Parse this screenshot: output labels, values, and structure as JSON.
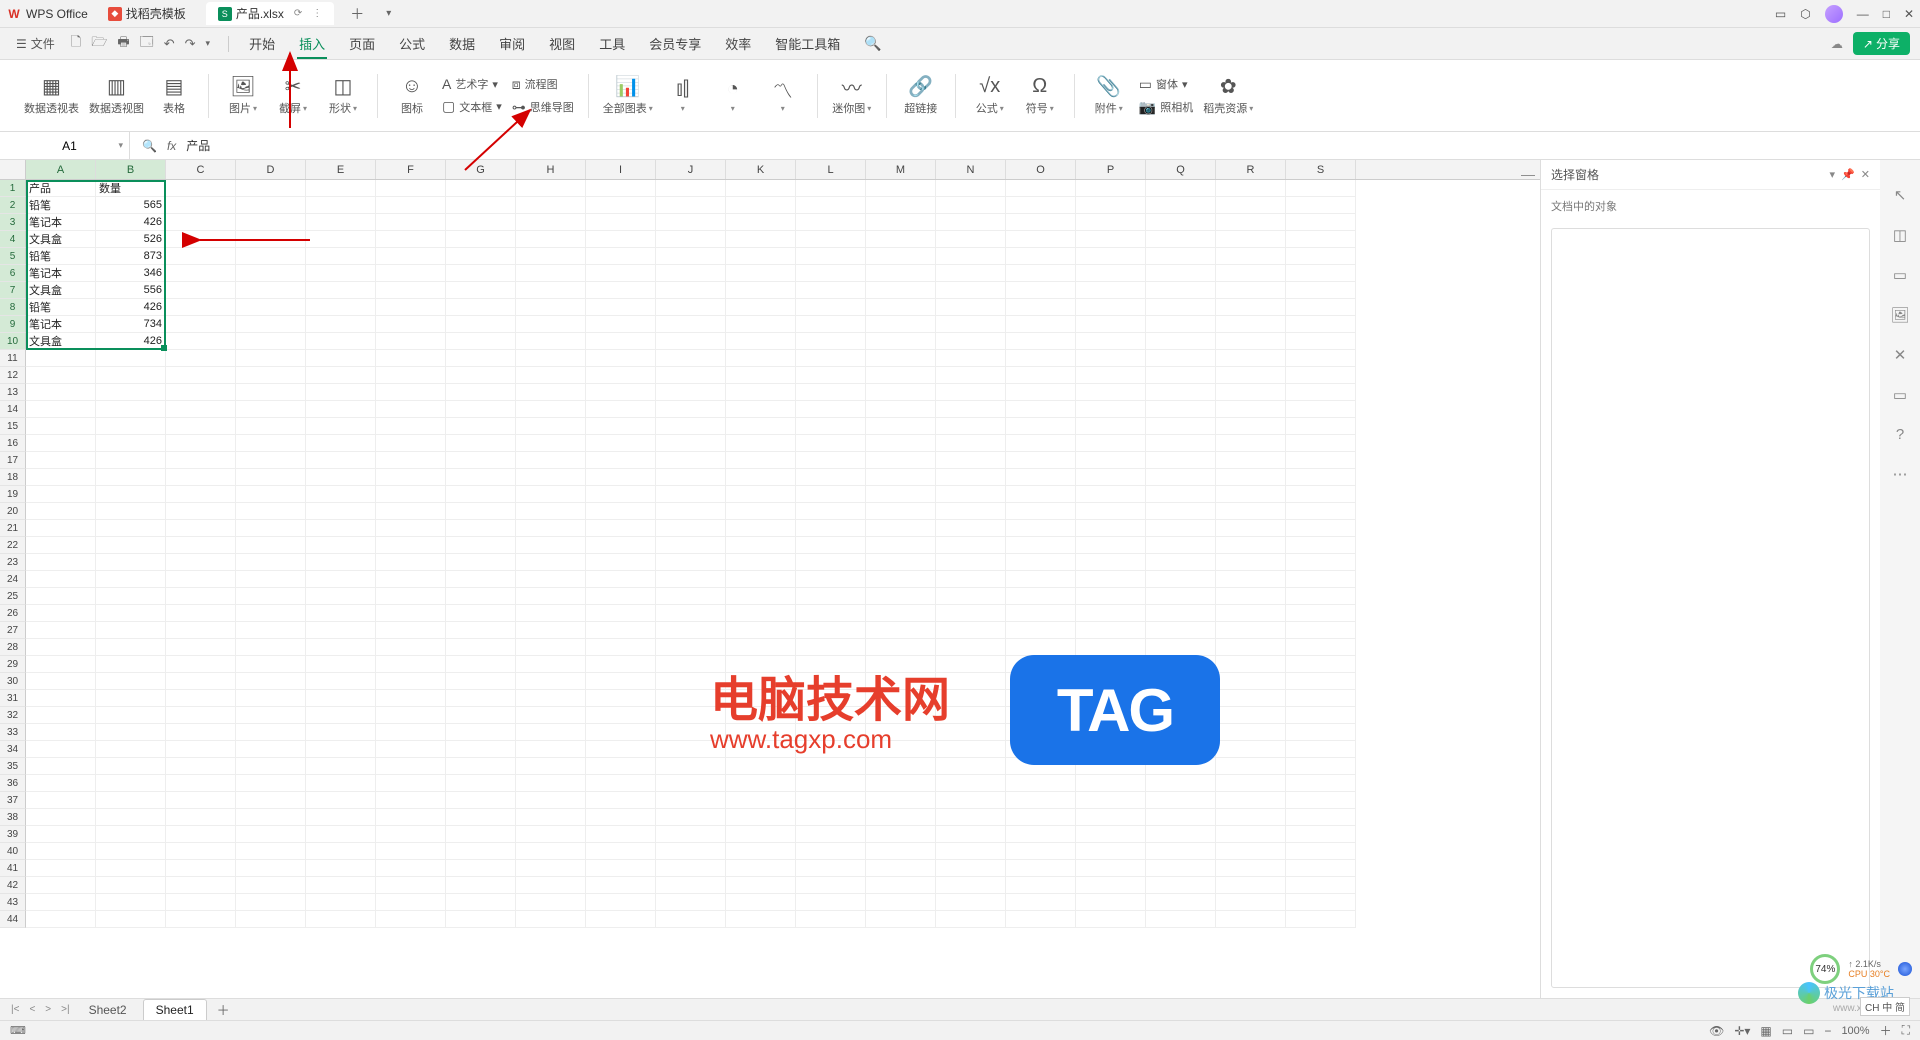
{
  "app": {
    "name": "WPS Office"
  },
  "tabs": {
    "inactive_label": "找稻壳模板",
    "active_label": "产品.xlsx"
  },
  "win": {
    "minimize": "—",
    "maximize": "□",
    "close": "✕"
  },
  "menu": {
    "file": "文件",
    "tabs": [
      "开始",
      "插入",
      "页面",
      "公式",
      "数据",
      "审阅",
      "视图",
      "工具",
      "会员专享",
      "效率",
      "智能工具箱"
    ],
    "active_index": 1,
    "share": "分享"
  },
  "ribbon": {
    "g1": {
      "pivot_table": "数据透视表",
      "pivot_chart": "数据透视图",
      "table": "表格"
    },
    "g2": {
      "picture": "图片",
      "screenshot": "截屏",
      "shape": "形状"
    },
    "g3": {
      "icons": "图标",
      "wordart": "艺术字",
      "textbox": "文本框",
      "flowchart": "流程图",
      "mindmap": "思维导图"
    },
    "g4": {
      "all_charts": "全部图表"
    },
    "g5": {
      "sparkline": "迷你图"
    },
    "g6": {
      "hyperlink": "超链接"
    },
    "g7": {
      "formula": "公式",
      "symbol": "符号"
    },
    "g8": {
      "attachment": "附件",
      "camera": "照相机",
      "form": "窗体",
      "resources": "稻壳资源"
    }
  },
  "formula": {
    "cell_ref": "A1",
    "value": "产品"
  },
  "columns": [
    "A",
    "B",
    "C",
    "D",
    "E",
    "F",
    "G",
    "H",
    "I",
    "J",
    "K",
    "L",
    "M",
    "N",
    "O",
    "P",
    "Q",
    "R",
    "S"
  ],
  "selected_cols": [
    "A",
    "B"
  ],
  "selected_rows": [
    1,
    2,
    3,
    4,
    5,
    6,
    7,
    8,
    9,
    10
  ],
  "data_rows": [
    {
      "r": 1,
      "a": "产品",
      "b": "数量",
      "b_align": "left"
    },
    {
      "r": 2,
      "a": "铅笔",
      "b": "565"
    },
    {
      "r": 3,
      "a": "笔记本",
      "b": "426"
    },
    {
      "r": 4,
      "a": "文具盒",
      "b": "526"
    },
    {
      "r": 5,
      "a": "铅笔",
      "b": "873"
    },
    {
      "r": 6,
      "a": "笔记本",
      "b": "346"
    },
    {
      "r": 7,
      "a": "文具盒",
      "b": "556"
    },
    {
      "r": 8,
      "a": "铅笔",
      "b": "426"
    },
    {
      "r": 9,
      "a": "笔记本",
      "b": "734"
    },
    {
      "r": 10,
      "a": "文具盒",
      "b": "426"
    }
  ],
  "empty_rows": 34,
  "sheets": {
    "inactive": "Sheet2",
    "active": "Sheet1"
  },
  "side_panel": {
    "title": "选择窗格",
    "sub": "文档中的对象"
  },
  "status": {
    "zoom": "100%"
  },
  "watermark": {
    "title": "电脑技术网",
    "url": "www.tagxp.com",
    "tag": "TAG",
    "site": "极光下载站",
    "site_url": "www.xz7.com"
  },
  "perf": {
    "pct": "74%",
    "net": "2.1K/s",
    "cpu": "CPU 30°C",
    "ime": "CH 中 简"
  }
}
